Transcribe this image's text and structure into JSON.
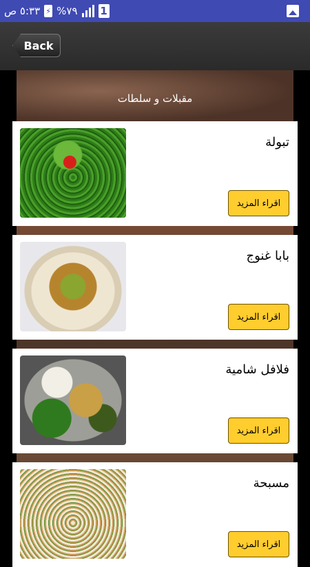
{
  "status_bar": {
    "time": "٥:٣٣ ص",
    "battery": "%٧٩",
    "sim": "1"
  },
  "app_bar": {
    "back_label": "Back"
  },
  "category": {
    "title": "مقبلات و سلطات"
  },
  "recipes": [
    {
      "name": "تبولة",
      "more_label": "اقراء المزيد"
    },
    {
      "name": "بابا غنوج",
      "more_label": "اقراء المزيد"
    },
    {
      "name": "فلافل شامية",
      "more_label": "اقراء المزيد"
    },
    {
      "name": "مسبحة",
      "more_label": "اقراء المزيد"
    }
  ],
  "colors": {
    "status_bar": "#3f4ab3",
    "button_accent": "#ffcd2e"
  }
}
